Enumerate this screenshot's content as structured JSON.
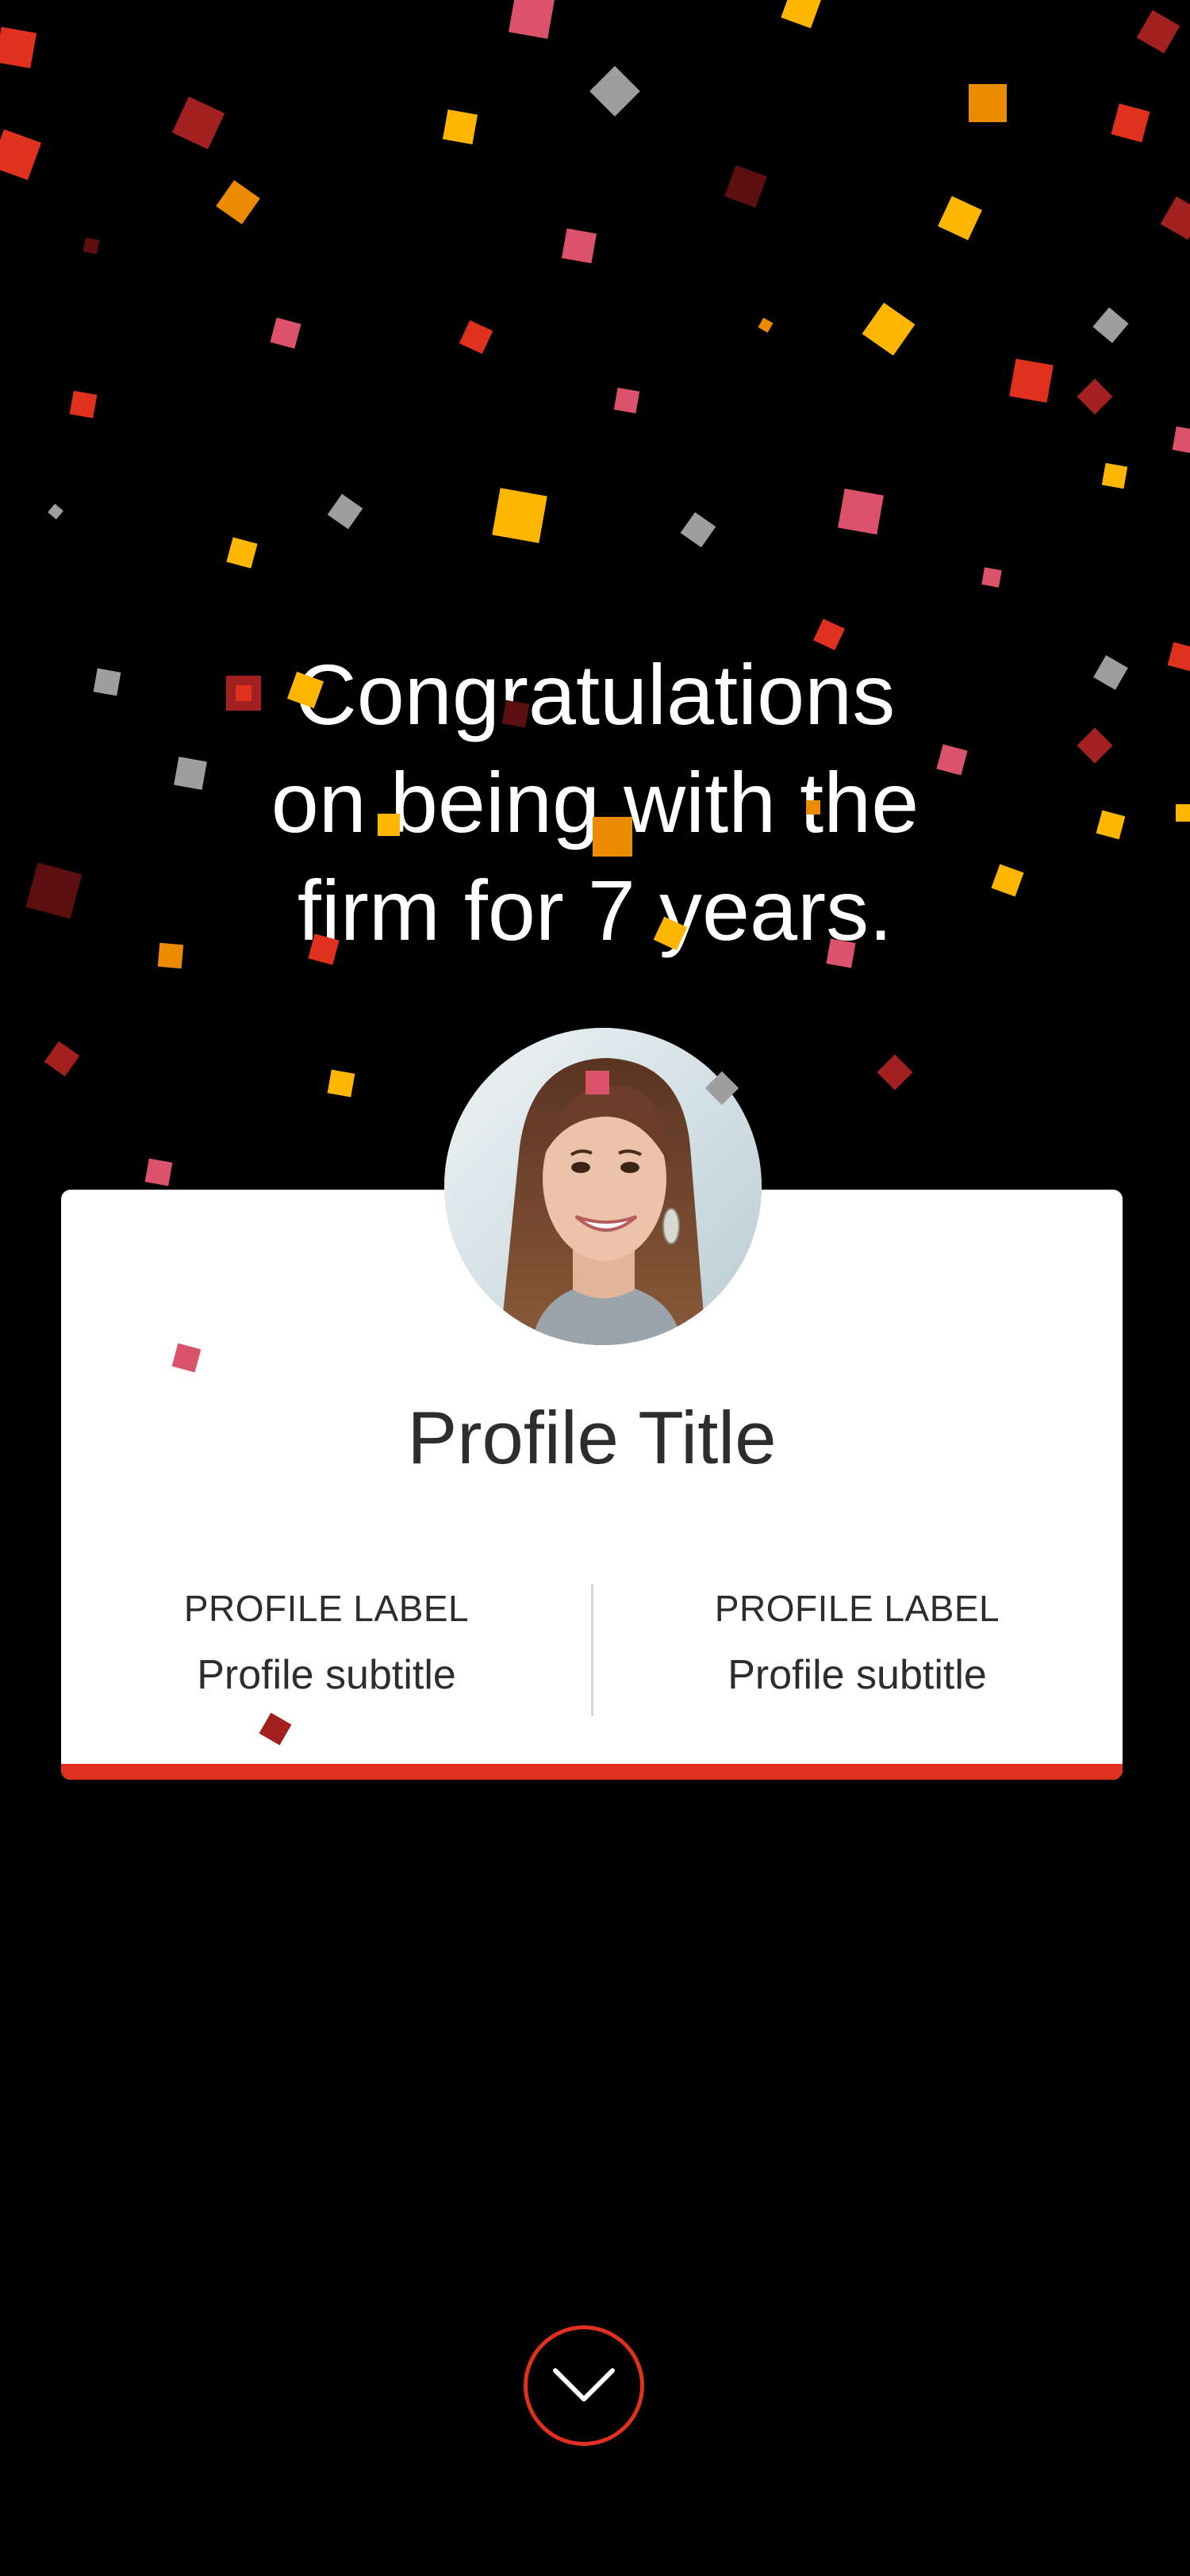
{
  "headline": {
    "line1": "Congratulations",
    "line2": "on being with the",
    "line3": "firm for 7 years."
  },
  "card": {
    "avatar_alt": "Profile photo",
    "title": "Profile Title",
    "columns": [
      {
        "label": "PROFILE LABEL",
        "subtitle": "Profile subtitle"
      },
      {
        "label": "PROFILE LABEL",
        "subtitle": "Profile subtitle"
      }
    ]
  },
  "scroll_button_icon": "chevron-down-icon",
  "colors": {
    "background": "#000000",
    "accent": "#e0301e",
    "text_dark": "#2d2d2d",
    "confetti": [
      "#e0301e",
      "#ffb600",
      "#eb8c00",
      "#db536a",
      "#a32020",
      "#9e9e9e",
      "#5c0f0f"
    ]
  }
}
